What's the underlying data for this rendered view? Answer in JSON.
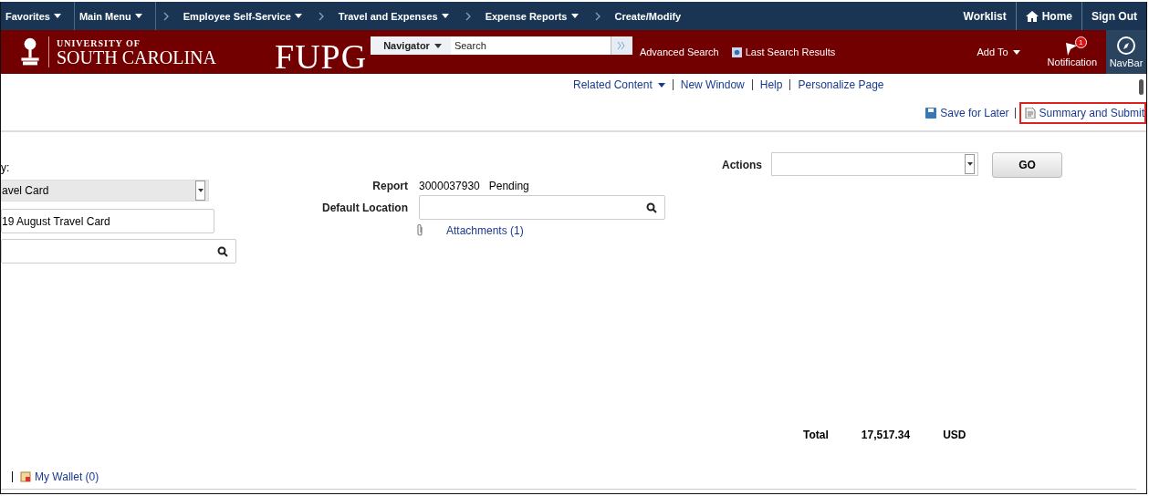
{
  "top_nav": {
    "menus": [
      {
        "label": "Favorites",
        "dropdown": true,
        "separator_before": false
      },
      {
        "label": "Main Menu",
        "dropdown": true,
        "separator_before": false
      },
      {
        "label": "Employee Self-Service",
        "dropdown": true,
        "separator_before": true
      },
      {
        "label": "Travel and Expenses",
        "dropdown": true,
        "separator_before": true
      },
      {
        "label": "Expense Reports",
        "dropdown": true,
        "separator_before": true
      },
      {
        "label": "Create/Modify",
        "dropdown": false,
        "separator_before": true
      }
    ],
    "right_links": [
      {
        "label": "Worklist",
        "kind": "text"
      },
      {
        "label": "Home",
        "kind": "home"
      },
      {
        "label": "Sign Out",
        "kind": "bold"
      }
    ]
  },
  "header": {
    "logo_small": "UNIVERSITY OF",
    "logo_large": "SOUTH CAROLINA",
    "app_title": "FUPG",
    "navigator": "Navigator",
    "search_placeholder": "Search",
    "advanced_search": "Advanced Search",
    "last_search_results": "Last Search Results",
    "add_to": "Add To",
    "notification": {
      "label": "Notification",
      "count": "1"
    },
    "navbar": "NavBar"
  },
  "page_links": [
    "Related Content",
    "New Window",
    "Help",
    "Personalize Page"
  ],
  "toolbar": [
    {
      "label": "Save for Later",
      "highlighted": false
    },
    {
      "label": "Summary and Submit",
      "highlighted": true
    }
  ],
  "left_form": {
    "label": "y:",
    "select_value": "avel Card",
    "description": "19 August Travel Card"
  },
  "report": {
    "label": "Report",
    "number": "3000037930",
    "status": "Pending",
    "location_label": "Default Location",
    "attachments": "Attachments (1)"
  },
  "actions": {
    "label": "Actions",
    "button": "GO"
  },
  "total": {
    "label": "Total",
    "amount": "17,517.34",
    "currency": "USD"
  },
  "wallet": "My Wallet (0)"
}
